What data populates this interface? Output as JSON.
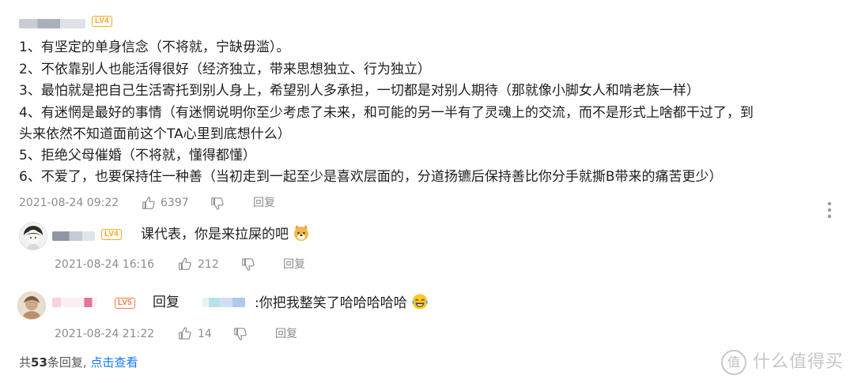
{
  "main_comment": {
    "level": "LV4",
    "lines": [
      "1、有坚定的单身信念（不将就，宁缺毋滥）。",
      "2、不依靠别人也能活得很好（经济独立，带来思想独立、行为独立）",
      "3、最怕就是把自己生活寄托到别人身上，希望别人多承担，一切都是对别人期待（那就像小脚女人和啃老族一样）",
      "4、有迷惘是最好的事情（有迷惘说明你至少考虑了未来，和可能的另一半有了灵魂上的交流，而不是形式上啥都干过了，到",
      "头来依然不知道面前这个TA心里到底想什么）",
      "5、拒绝父母催婚（不将就，懂得都懂）",
      "6、不爱了，也要保持住一种善（当初走到一起至少是喜欢层面的，分道扬镳后保持善比你分手就撕B带来的痛苦更少）"
    ],
    "timestamp": "2021-08-24 09:22",
    "likes": "6397",
    "reply_label": "回复"
  },
  "replies": [
    {
      "level": "LV4",
      "text": "课代表，你是来拉屎的吧",
      "emoji": "dog-face-emoji",
      "timestamp": "2021-08-24 16:16",
      "likes": "212",
      "reply_label": "回复"
    },
    {
      "level": "LV5",
      "reply_prefix": "回复",
      "text": ":你把我整笑了哈哈哈哈哈",
      "emoji": "tears-of-joy-emoji",
      "timestamp": "2021-08-24 21:22",
      "likes": "14",
      "reply_label": "回复"
    }
  ],
  "footer": {
    "total_prefix": "共",
    "total_count": "53",
    "total_suffix": "条回复,",
    "view_link": "点击查看"
  },
  "watermark": {
    "logo_char": "值",
    "text": "什么值得买"
  },
  "colors": {
    "lv4": "#f5a623",
    "lv5": "#ff7a45",
    "link": "#1677ff",
    "meta": "#8c8c8c"
  }
}
